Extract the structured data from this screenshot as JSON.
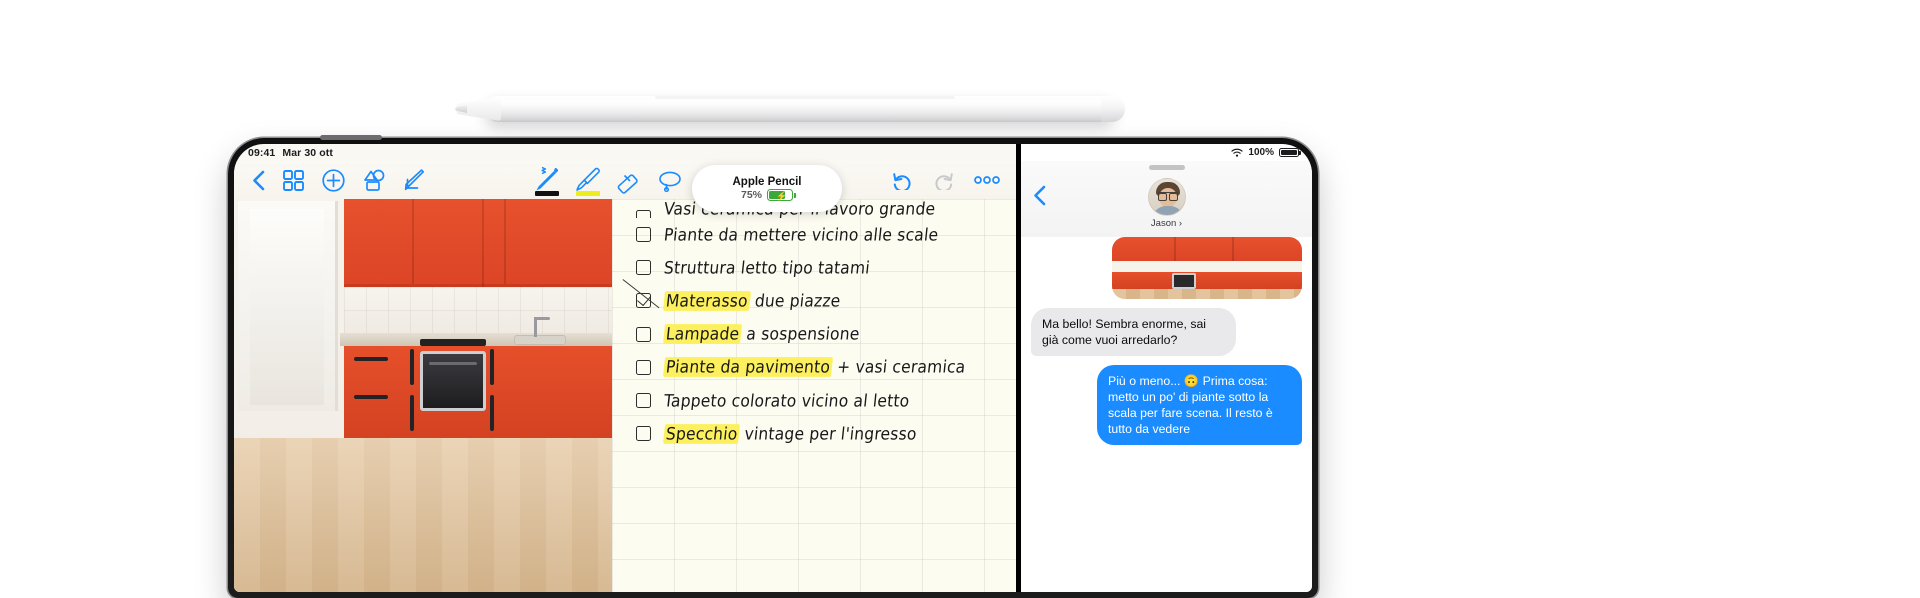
{
  "device": {
    "name": "ipad-pro",
    "accent": "#1a8cff"
  },
  "pencil": {
    "name": "Apple Pencil"
  },
  "notes": {
    "statusbar": {
      "time": "09:41",
      "date": "Mar 30 ott"
    },
    "toolbar": {
      "back": "back-chevron",
      "grid": "gallery-grid",
      "add": "add-circle",
      "shapes": "shapes",
      "compose": "compose",
      "undo": "undo",
      "redo": "redo",
      "more": "•••"
    },
    "tools": [
      {
        "name": "pen",
        "color": "#111111",
        "selected": true
      },
      {
        "name": "highlighter",
        "color": "#ecec1e",
        "selected": true
      },
      {
        "name": "eraser",
        "color": "#1a8cff",
        "selected": false
      },
      {
        "name": "lasso",
        "color": "#1a8cff",
        "selected": false
      },
      {
        "name": "pencil-off",
        "color": "#1a8cff",
        "selected": false
      }
    ],
    "pencil_popup": {
      "title": "Apple Pencil",
      "battery_percent": "75%",
      "battery_level": 75,
      "charging": true
    },
    "checklist": [
      {
        "text_pre": "",
        "highlight": "",
        "text_post": "Vasi ceramica per il lavoro grande",
        "checked": false,
        "partial": true
      },
      {
        "text_pre": "",
        "highlight": "",
        "text_post": "Piante da mettere vicino alle scale",
        "checked": false,
        "partial": false
      },
      {
        "text_pre": "",
        "highlight": "",
        "text_post": "Struttura letto tipo tatami",
        "checked": false,
        "partial": false
      },
      {
        "text_pre": "",
        "highlight": "Materasso",
        "text_post": " due piazze",
        "checked": true,
        "partial": false
      },
      {
        "text_pre": "",
        "highlight": "Lampade",
        "text_post": " a sospensione",
        "checked": false,
        "partial": false
      },
      {
        "text_pre": "",
        "highlight": "Piante da pavimento",
        "text_post": " + vasi ceramica",
        "checked": false,
        "partial": false
      },
      {
        "text_pre": "",
        "highlight": "",
        "text_post": "Tappeto colorato vicino al letto",
        "checked": false,
        "partial": false
      },
      {
        "text_pre": "",
        "highlight": "Specchio",
        "text_post": " vintage per l'ingresso",
        "checked": false,
        "partial": false
      }
    ]
  },
  "messages": {
    "statusbar": {
      "wifi": "wifi-icon",
      "battery_percent": "100%",
      "battery_icon": "battery-full-icon"
    },
    "header": {
      "back": "back-chevron",
      "contact_name": "Jason ›",
      "avatar": "contact-avatar"
    },
    "thread": [
      {
        "from": "them",
        "text": "Ma bello! Sembra enorme, sai già come vuoi arredarlo?"
      },
      {
        "from": "me",
        "text": "Più o meno... 🙃 Prima cosa: metto un po' di piante sotto la scala per fare scena. Il resto è tutto da vedere"
      }
    ]
  }
}
